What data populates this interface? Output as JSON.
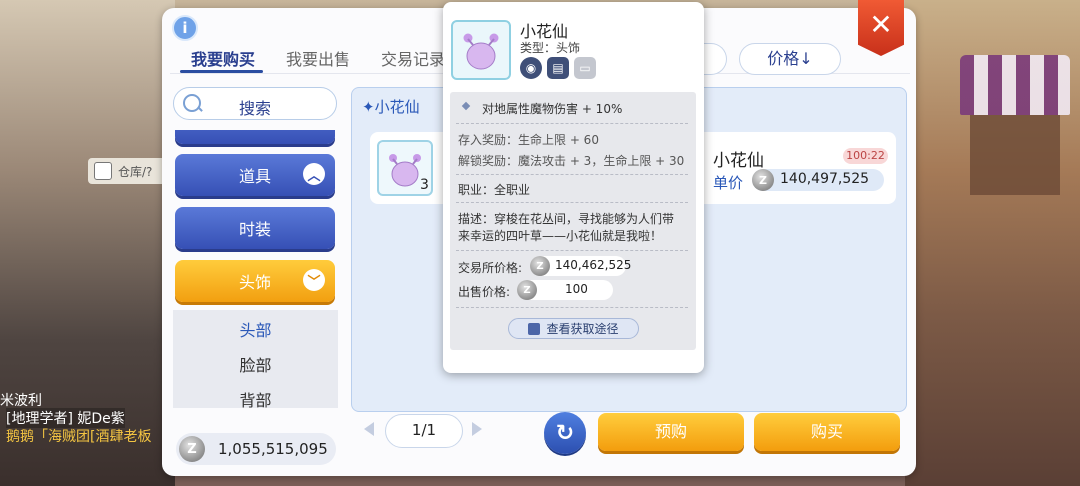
{
  "background": {
    "warehouse_label": "仓库/?",
    "hud_lines": [
      "米波利",
      "[地理学者] 妮De紫",
      "鹅鹅「海贼团[酒肆老板"
    ]
  },
  "tabs": [
    {
      "label": "我要购买",
      "active": true
    },
    {
      "label": "我要出售",
      "active": false
    },
    {
      "label": "交易记录",
      "active": false
    }
  ],
  "info_icon": "i",
  "sort_label": "价格↓",
  "search_label": "搜索",
  "categories": [
    {
      "label": "道具",
      "chevron": "^"
    },
    {
      "label": "时装"
    },
    {
      "label": "头饰",
      "chevron": "v"
    }
  ],
  "subcategories": [
    {
      "label": "头部",
      "active": true
    },
    {
      "label": "脸部",
      "active": false
    },
    {
      "label": "背部",
      "active": false
    }
  ],
  "wallet": {
    "coin": "Z",
    "balance": "1,055,515,095"
  },
  "list": {
    "title": "✦小花仙",
    "item": {
      "quantity": "3",
      "name": "小花仙",
      "timer": "100:22",
      "price_label": "单价",
      "price": "140,497,525"
    }
  },
  "pager": {
    "page": "1/1"
  },
  "buttons": {
    "refresh": "↻",
    "preorder": "预购",
    "buy": "购买",
    "close": "✕"
  },
  "tooltip": {
    "name": "小花仙",
    "type": "类型：头饰",
    "effect": "对地属性魔物伤害 + 10%",
    "deposit_reward": "存入奖励：生命上限 + 60",
    "unlock_reward": "解锁奖励：魔法攻击 + 3，生命上限 + 30",
    "job": "职业：全职业",
    "desc_line1": "描述：穿梭在花丛间，寻找能够为人们带",
    "desc_line2": "来幸运的四叶草——小花仙就是我啦！",
    "exchange_price_label": "交易所价格:",
    "exchange_price": "140,462,525",
    "sell_price_label": "出售价格:",
    "sell_price": "100",
    "route_button": "查看获取途径"
  },
  "colors": {
    "accent": "#2a4da1",
    "orange": "#f29f10",
    "close": "#d9391f"
  }
}
